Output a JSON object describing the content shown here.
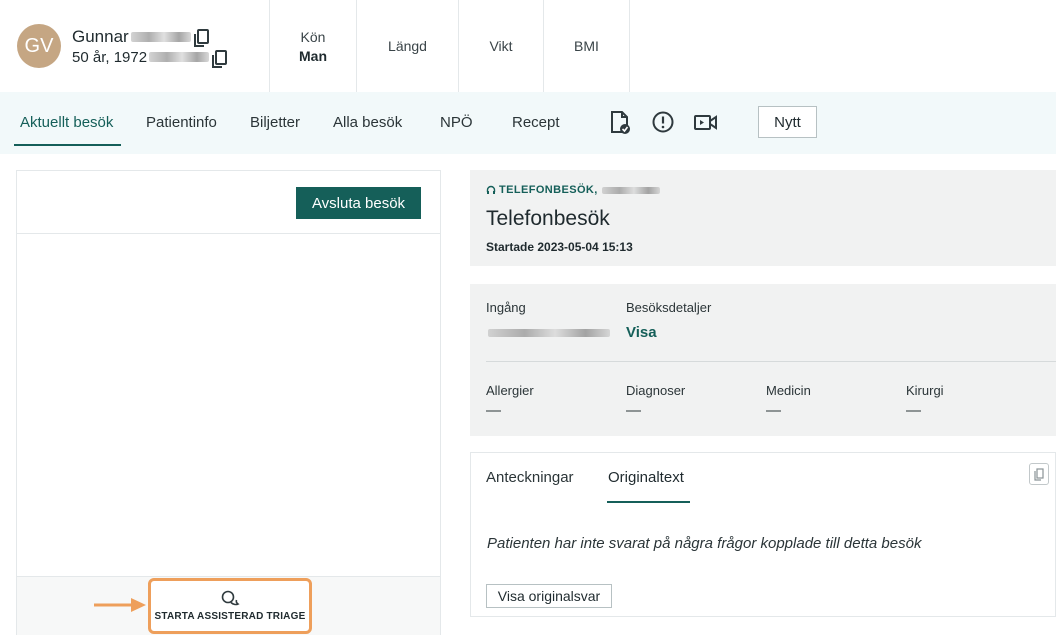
{
  "patient": {
    "initials": "GV",
    "first_name": "Gunnar",
    "age_year": "50 år, 1972"
  },
  "stats": [
    {
      "label": "Kön",
      "value": "Man"
    },
    {
      "label": "Längd",
      "value": ""
    },
    {
      "label": "Vikt",
      "value": ""
    },
    {
      "label": "BMI",
      "value": ""
    }
  ],
  "tabs": [
    "Aktuellt besök",
    "Patientinfo",
    "Biljetter",
    "Alla besök",
    "NPÖ",
    "Recept"
  ],
  "tab_icons": [
    "document-check-icon",
    "alert-circle-icon",
    "video-camera-icon"
  ],
  "nytt_label": "Nytt",
  "left_panel": {
    "end_visit_label": "Avsluta besök",
    "triage_label": "STARTA ASSISTERAD TRIAGE"
  },
  "visit": {
    "type_label": "TELEFONBESÖK,",
    "title": "Telefonbesök",
    "started": "Startade 2023-05-04 15:13"
  },
  "details": {
    "ingang_label": "Ingång",
    "besoksdetaljer_label": "Besöksdetaljer",
    "visa_label": "Visa",
    "fields": [
      {
        "label": "Allergier",
        "value": "—"
      },
      {
        "label": "Diagnoser",
        "value": "—"
      },
      {
        "label": "Medicin",
        "value": "—"
      },
      {
        "label": "Kirurgi",
        "value": "—"
      }
    ]
  },
  "content_tabs": [
    "Anteckningar",
    "Originaltext"
  ],
  "content_message": "Patienten har inte svarat på några frågor kopplade till detta besök",
  "show_original_label": "Visa originalsvar",
  "colors": {
    "primary": "#155f59",
    "avatar": "#c5a683",
    "highlight": "#ee9f5b",
    "tabs_bg": "#f2f9fa",
    "card_bg": "#f1f2f2"
  }
}
